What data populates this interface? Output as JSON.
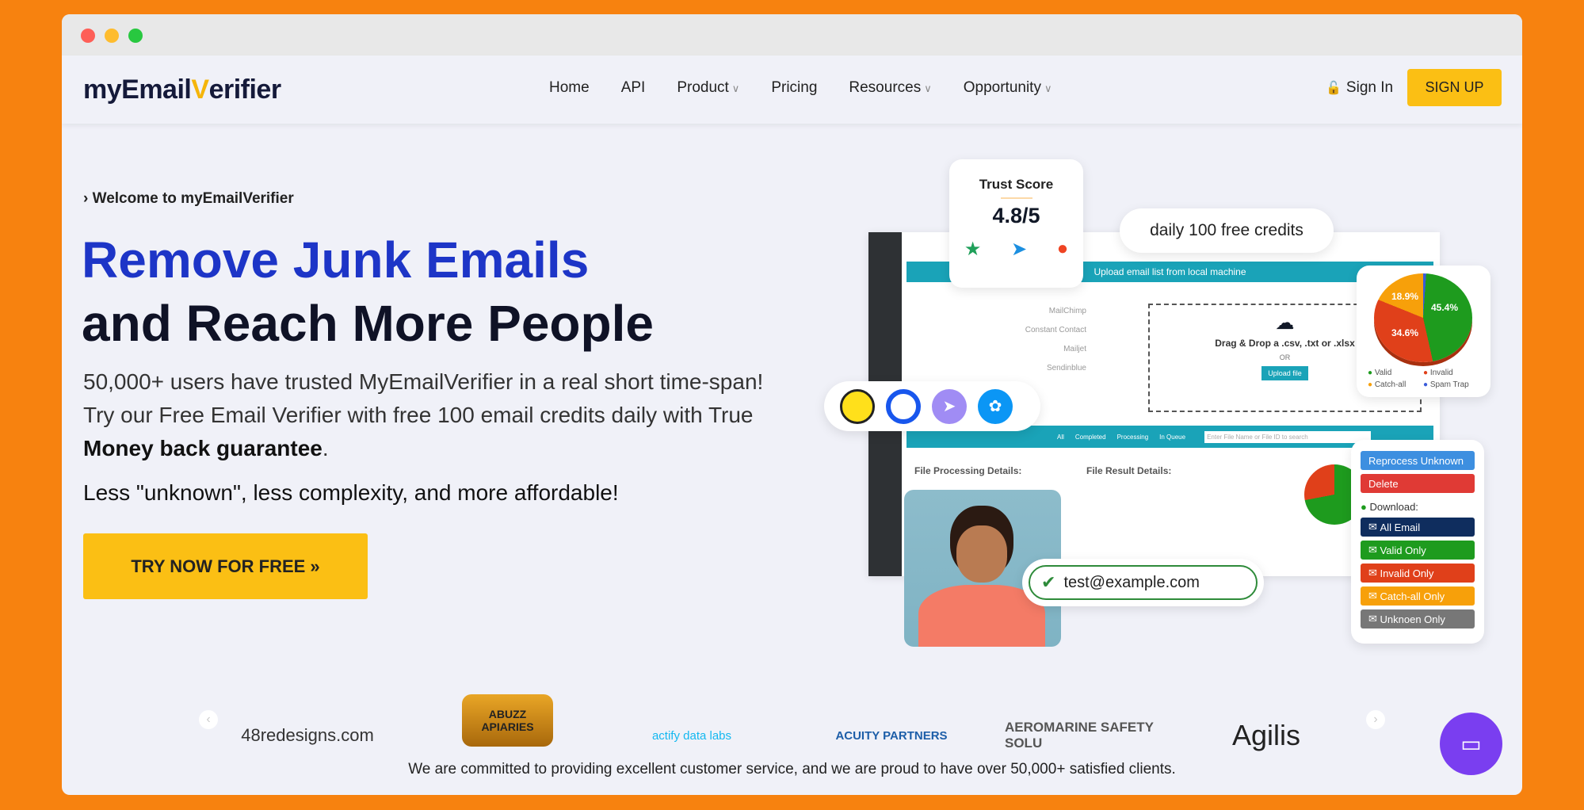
{
  "brand": {
    "logo_text_a": "myE",
    "logo_text_b": "mail",
    "logo_text_c": "V",
    "logo_text_d": "erifier"
  },
  "nav": {
    "items": [
      {
        "label": "Home"
      },
      {
        "label": "API"
      },
      {
        "label": "Product",
        "dropdown": true
      },
      {
        "label": "Pricing"
      },
      {
        "label": "Resources",
        "dropdown": true
      },
      {
        "label": "Opportunity",
        "dropdown": true
      }
    ],
    "sign_in": "Sign In",
    "sign_up": "SIGN UP"
  },
  "hero": {
    "eyebrow": "Welcome to myEmailVerifier",
    "headline_1": "Remove Junk Emails",
    "headline_2": "and Reach More People",
    "paragraph_start": "50,000+ users have trusted MyEmailVerifier in a real short time-span! Try our Free Email Verifier with free 100 email credits daily with True ",
    "paragraph_bold": "Money back guarantee",
    "paragraph_end": ".",
    "tagline": "Less \"unknown\", less complexity, and more affordable!",
    "cta": "TRY NOW FOR FREE »"
  },
  "mockup": {
    "trust_title": "Trust Score",
    "trust_score": "4.8/5",
    "credits": "daily 100 free credits",
    "upload_header": "Upload email list from local machine",
    "integrations": [
      "MailChimp",
      "Constant Contact",
      "Mailjet",
      "Sendinblue"
    ],
    "drop_text": "Drag & Drop a .csv, .txt or .xlsx",
    "or": "OR",
    "upload_btn": "Upload file",
    "tabs": [
      "All",
      "Completed",
      "Processing",
      "In Queue"
    ],
    "search_placeholder": "Enter File Name or File ID to search",
    "processing_title": "File Processing Details:",
    "result_title": "File Result Details:",
    "email": "test@example.com",
    "pie": {
      "slices": [
        {
          "label": "Valid",
          "value": 45.4,
          "color": "#1e9b1e"
        },
        {
          "label": "Invalid",
          "value": 34.6,
          "color": "#e0401a"
        },
        {
          "label": "Catch-all",
          "value": 18.9,
          "color": "#f7a00a"
        },
        {
          "label": "Spam Trap",
          "value": 1.1,
          "color": "#3a5bd9"
        }
      ]
    },
    "actions": {
      "reprocess": "Reprocess Unknown",
      "delete": "Delete",
      "download": "Download:",
      "all": "All Email",
      "valid": "Valid Only",
      "invalid": "Invalid Only",
      "catchall": "Catch-all Only",
      "unknown": "Unknoen Only"
    }
  },
  "clients": [
    "48redesigns.com",
    "ABUZZ APIARIES",
    "actify data labs",
    "ACUITY PARTNERS",
    "AEROMARINE SAFETY SOLU",
    "Agilis"
  ],
  "footer_text": "We are committed to providing excellent customer service, and we are proud to have over 50,000+ satisfied clients.",
  "colors": {
    "accent": "#fbbf14",
    "headline_blue": "#1d35c7",
    "background": "#f7820f",
    "teal": "#1aa3b8"
  }
}
